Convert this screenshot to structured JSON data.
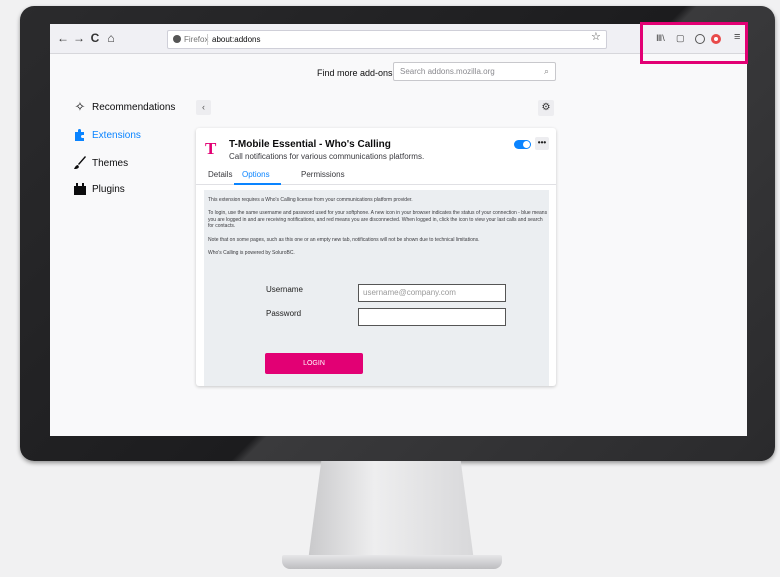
{
  "toolbar": {
    "back": "←",
    "forward": "→",
    "reload": "C",
    "home": "⌂",
    "url_prefix": "Firefox",
    "url": "about:addons",
    "star": "☆",
    "library": "Ⅲ\\",
    "sidebar_toggle": "▢",
    "menu": "≡"
  },
  "find_more": {
    "label": "Find more add-ons",
    "placeholder": "Search addons.mozilla.org"
  },
  "sidebar": {
    "items": [
      {
        "label": "Recommendations",
        "icon": "puzzle-star-icon"
      },
      {
        "label": "Extensions",
        "icon": "puzzle-icon"
      },
      {
        "label": "Themes",
        "icon": "brush-icon"
      },
      {
        "label": "Plugins",
        "icon": "plugin-icon"
      }
    ]
  },
  "addon": {
    "logo": "T",
    "name": "T-Mobile Essential - Who's Calling",
    "description": "Call notifications for various communications platforms.",
    "more": "•••",
    "tabs": [
      "Details",
      "Options",
      "Permissions"
    ],
    "options": {
      "paragraphs": [
        "This extension requires a Who's Calling license from your communications platform provider.",
        "To login, use the same username and password used for your softphone. A new icon in your browser indicates the status of your connection - blue means you are logged in and are receiving notifications, and red means you are disconnected. When logged in, click the icon to view your last calls and search for contacts.",
        "Note that on some pages, such as this one or an empty new tab, notifications will not be shown due to technical limitations.",
        "Who's Calling is powered by SoluroBC."
      ],
      "username_label": "Username",
      "username_placeholder": "username@company.com",
      "password_label": "Password",
      "login": "LOGIN"
    }
  },
  "colors": {
    "brand": "#e20074",
    "accent": "#0a84ff"
  }
}
